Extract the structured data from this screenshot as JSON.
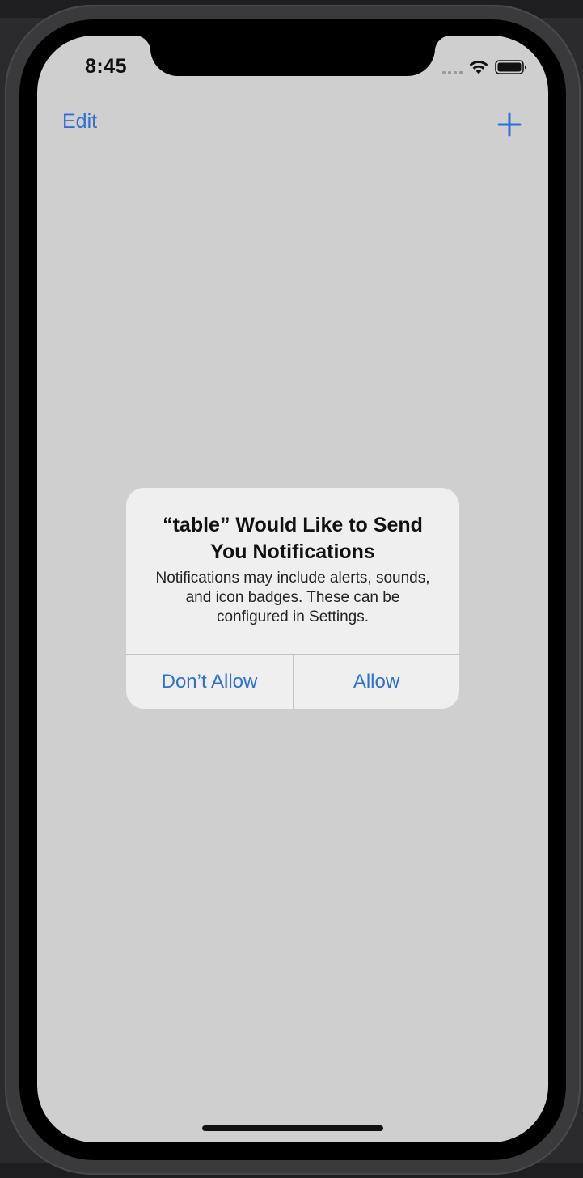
{
  "status_bar": {
    "time": "8:45",
    "icons": [
      "cellular-signal-icon",
      "wifi-icon",
      "battery-icon"
    ]
  },
  "nav_bar": {
    "edit_label": "Edit",
    "add_icon": "plus-icon"
  },
  "alert": {
    "title": "“table” Would Like to Send You Notifications",
    "message": "Notifications may include alerts, sounds, and icon badges. These can be configured in Settings.",
    "deny_label": "Don’t Allow",
    "allow_label": "Allow"
  },
  "colors": {
    "accent": "#2f6fd6",
    "screen_background": "#cfcfcf",
    "alert_background": "#efefef"
  }
}
